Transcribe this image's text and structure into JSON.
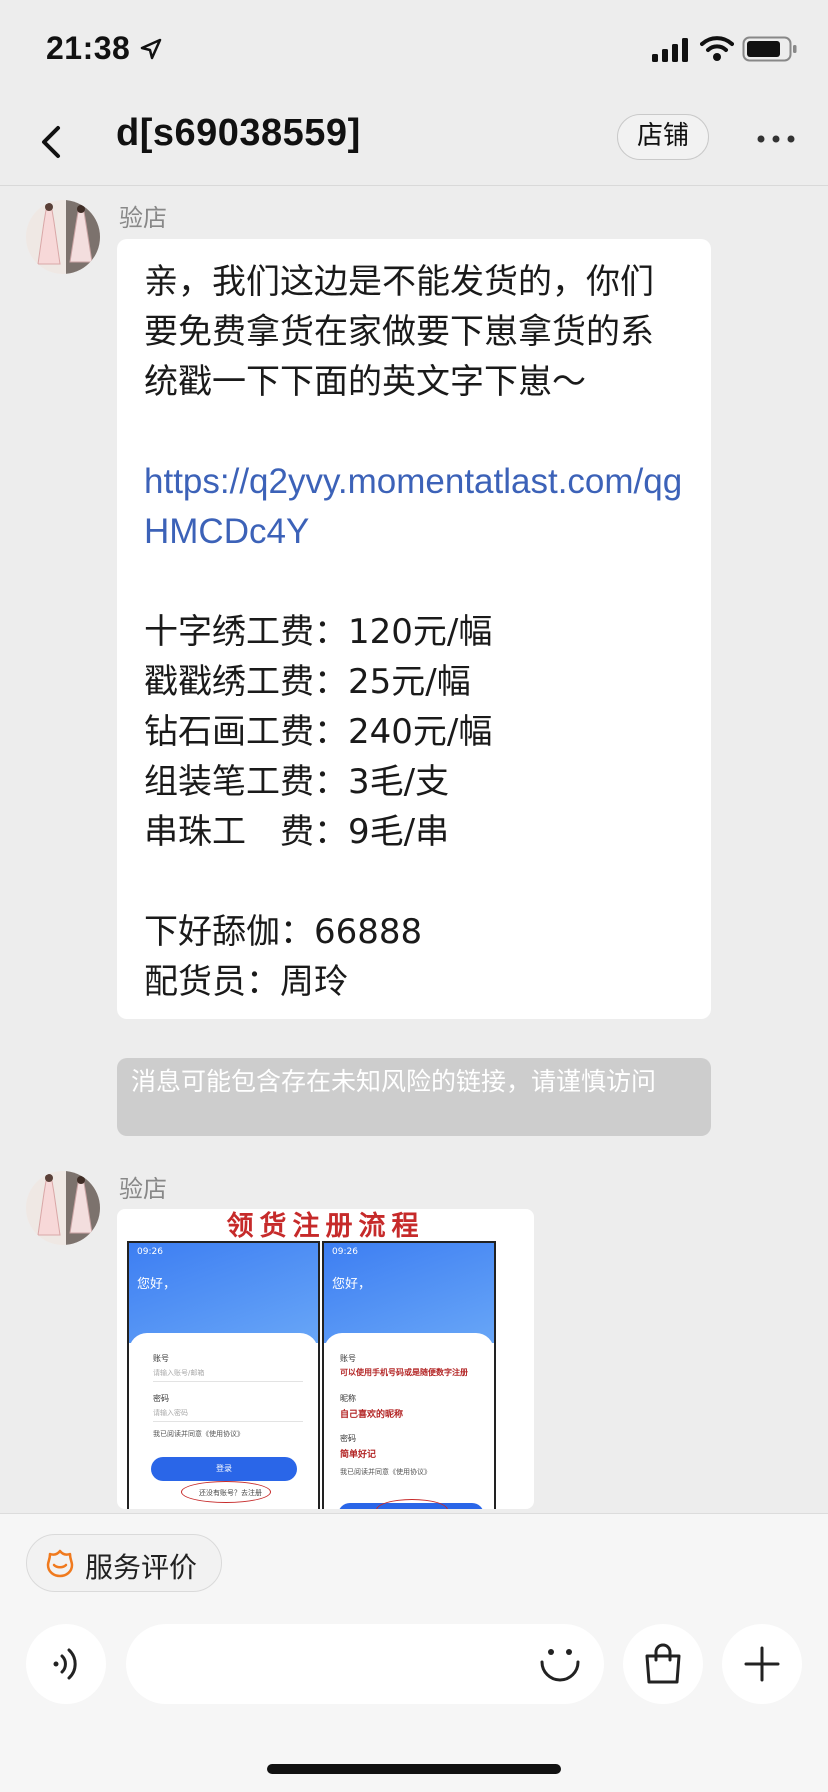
{
  "status_bar": {
    "time": "21:38"
  },
  "nav": {
    "title": "d[s69038559]",
    "shop_label": "店铺"
  },
  "messages": [
    {
      "sender": "验店",
      "lines": [
        "亲，我们这边是不能发货的，你们",
        "要免费拿货在家做要下崽拿货的系",
        "统戳一下下面的英文字下崽～",
        "",
        "",
        "",
        "十字绣工费：120元/幅",
        "戳戳绣工费：25元/幅",
        "钻石画工费：240元/幅",
        "组装笔工费：3毛/支",
        "串珠工　费：9毛/串",
        "",
        "下好舔伽：66888",
        "配货员：周玲"
      ],
      "link": "https://q2yvy.momentatlast.com/qgHMCDc4Y"
    },
    {
      "sender": "验店",
      "image": {
        "title": "领货注册流程",
        "left_phone": {
          "time": "09:26",
          "greeting": "您好，",
          "account_label": "账号",
          "account_hint": "请输入账号/邮箱",
          "password_label": "密码",
          "password_hint": "请输入密码",
          "agree_text": "我已阅读并同意《使用协议》",
          "login_label": "登录",
          "register_text": "还没有账号？去注册"
        },
        "right_phone": {
          "time": "09:26",
          "greeting": "您好，",
          "account_label": "账号",
          "account_note": "可以使用手机号码或是随便数字注册",
          "nickname_label": "昵称",
          "nickname_note": "自己喜欢的昵称",
          "password_label": "密码",
          "password_note": "简单好记",
          "agree_text": "我已阅读并同意《使用协议》"
        }
      }
    }
  ],
  "risk_warning": "消息可能包含存在未知风险的链接，请谨慎访问",
  "bottom": {
    "rate_label": "服务评价"
  },
  "colors": {
    "link": "#3c62b8",
    "title_red": "#c62a2a",
    "rate_icon": "#f07a1e"
  }
}
